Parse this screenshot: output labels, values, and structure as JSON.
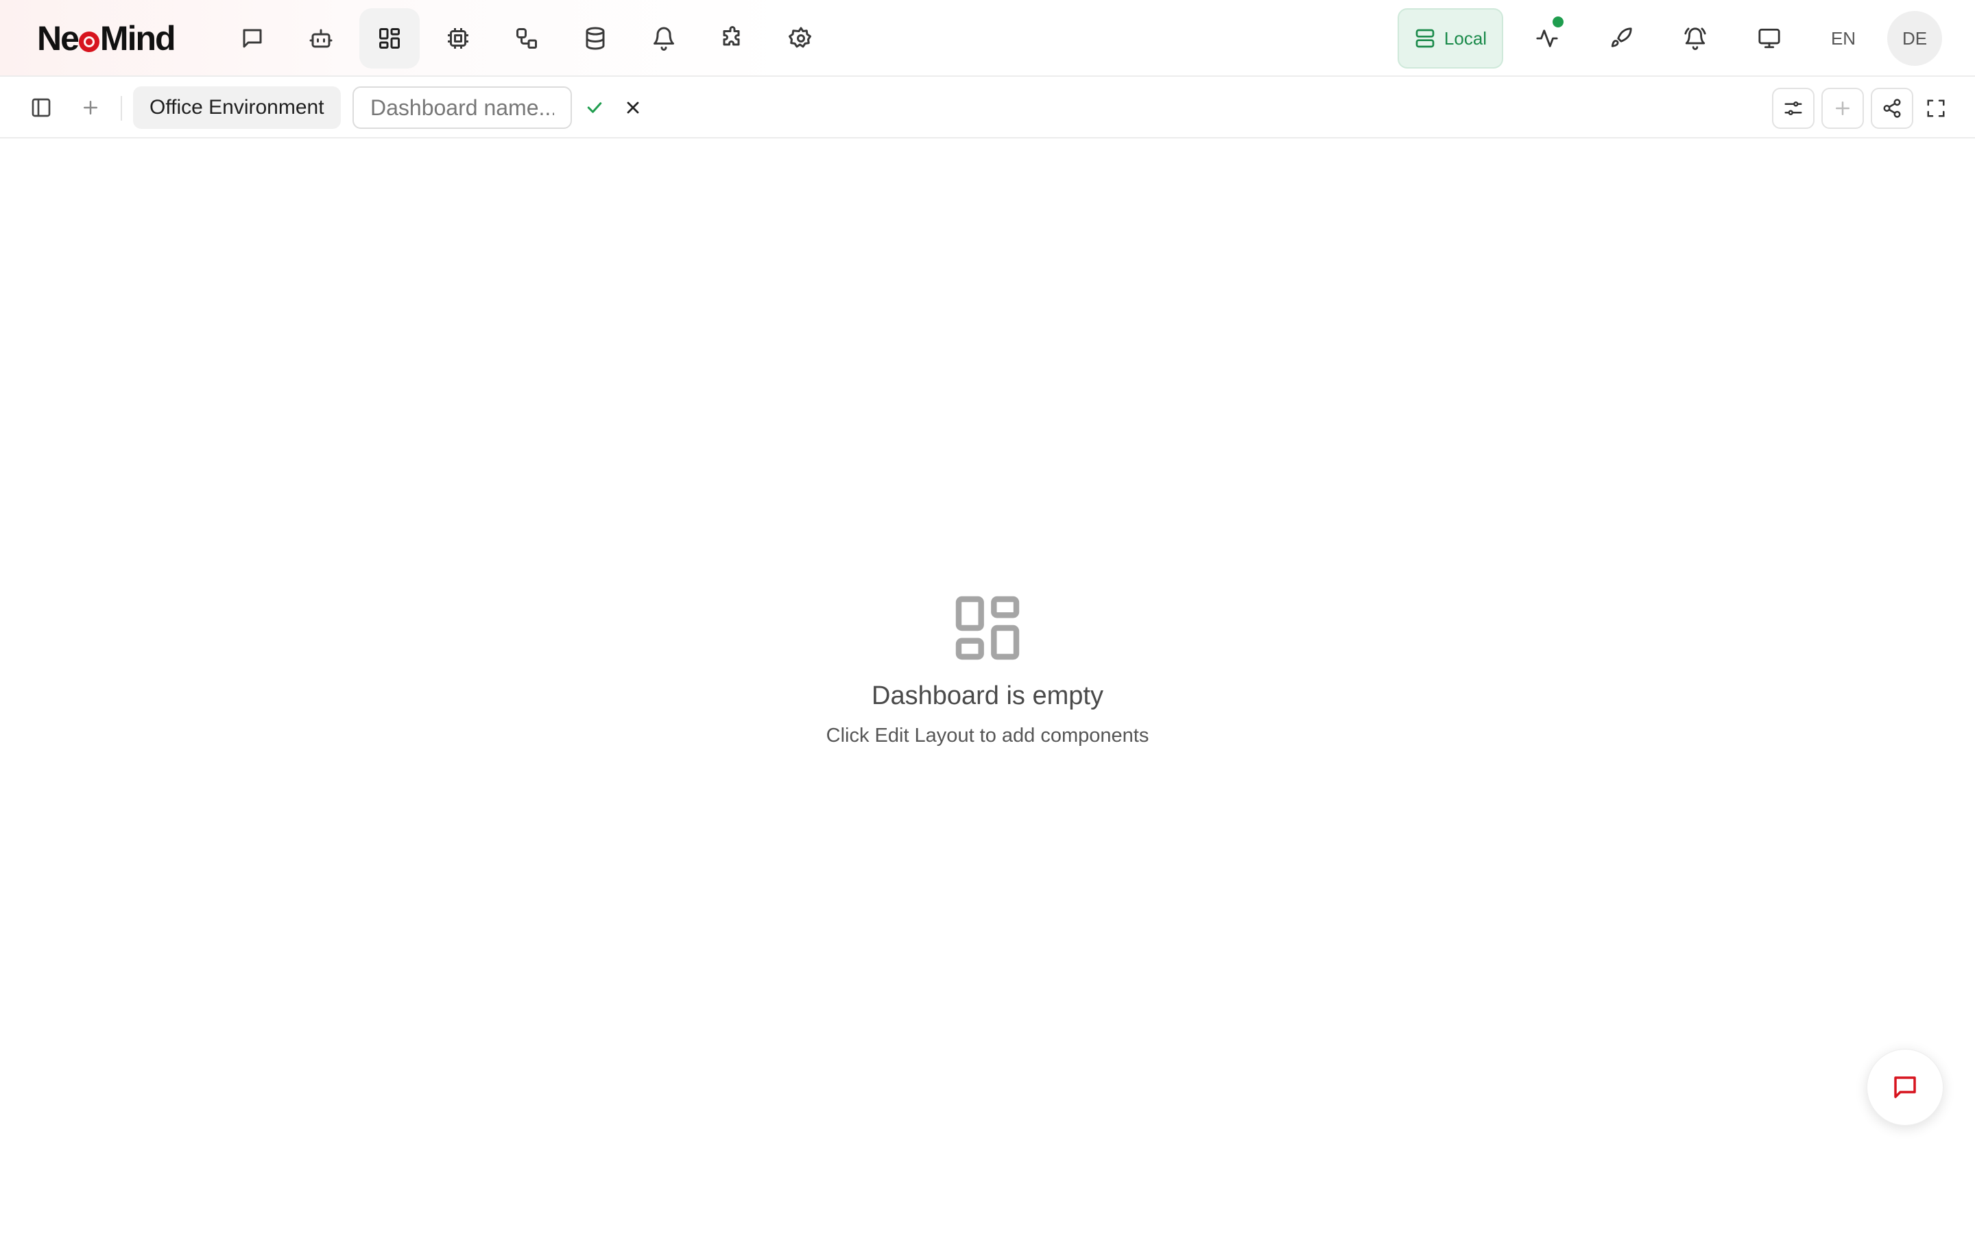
{
  "app": {
    "logo_text_a": "Ne",
    "logo_text_b": "Mind",
    "brand_color": "#d7141e"
  },
  "nav": {
    "items": [
      {
        "icon": "chat-icon"
      },
      {
        "icon": "robot-icon"
      },
      {
        "icon": "dashboard-icon",
        "active": true
      },
      {
        "icon": "chip-icon"
      },
      {
        "icon": "workflow-icon"
      },
      {
        "icon": "database-icon"
      },
      {
        "icon": "bell-icon"
      },
      {
        "icon": "puzzle-icon"
      },
      {
        "icon": "gear-icon"
      }
    ]
  },
  "header_right": {
    "local_label": "Local",
    "local_color": "#1a8a4a",
    "status_color": "#1f9d4e",
    "lang_en": "EN",
    "lang_de": "DE"
  },
  "toolbar": {
    "active_tab": "Office Environment",
    "name_input_value": "",
    "name_input_placeholder": "Dashboard name..."
  },
  "empty_state": {
    "title": "Dashboard is empty",
    "subtitle": "Click Edit Layout to add components"
  }
}
